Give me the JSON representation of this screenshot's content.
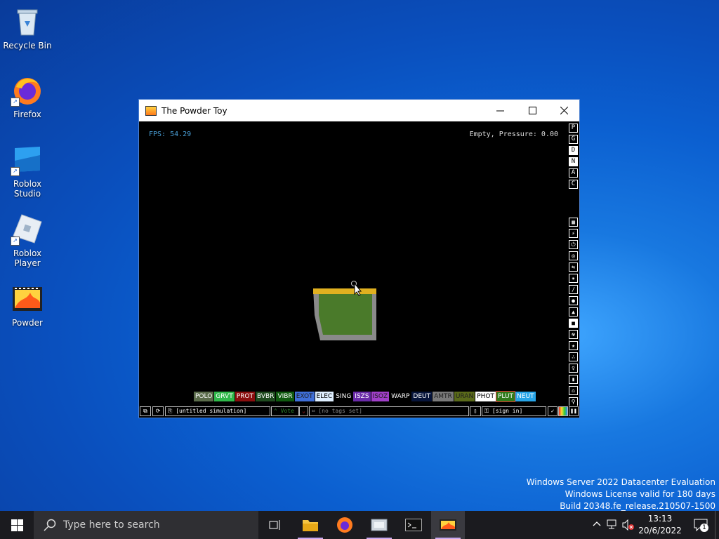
{
  "desktop": {
    "icons": [
      {
        "label": "Recycle Bin"
      },
      {
        "label": "Firefox"
      },
      {
        "label": "Roblox Studio"
      },
      {
        "label": "Roblox Player"
      },
      {
        "label": "Powder"
      }
    ]
  },
  "window": {
    "title": "The Powder Toy",
    "minimize": "—",
    "maximize": "☐",
    "close": "✕",
    "fps": "FPS: 54.29",
    "status": "Empty, Pressure: 0.00",
    "right_letters": [
      "P",
      "G",
      "D",
      "N",
      "A",
      "C"
    ],
    "elements": [
      {
        "label": "POLO",
        "bg": "#5a6b4a",
        "fg": "#ffffff"
      },
      {
        "label": "GRVT",
        "bg": "#2fb84a",
        "fg": "#ffffff"
      },
      {
        "label": "PROT",
        "bg": "#8a0e0e",
        "fg": "#ffffff"
      },
      {
        "label": "BVBR",
        "bg": "#1e4a1e",
        "fg": "#ffffff"
      },
      {
        "label": "VIBR",
        "bg": "#0f5a0f",
        "fg": "#ffffff"
      },
      {
        "label": "EXOT",
        "bg": "#3f6fd8",
        "fg": "#1e1e1e"
      },
      {
        "label": "ELEC",
        "bg": "#dfefff",
        "fg": "#000000"
      },
      {
        "label": "SING",
        "bg": "#000000",
        "fg": "#ffffff"
      },
      {
        "label": "ISZS",
        "bg": "#6a2aa8",
        "fg": "#ffffff"
      },
      {
        "label": "ISOZ",
        "bg": "#a03fc8",
        "fg": "#1e1e1e"
      },
      {
        "label": "WARP",
        "bg": "#000000",
        "fg": "#ffffff"
      },
      {
        "label": "DEUT",
        "bg": "#06143a",
        "fg": "#ffffff"
      },
      {
        "label": "AMTR",
        "bg": "#7a7a7a",
        "fg": "#1e1e1e"
      },
      {
        "label": "URAN",
        "bg": "#5a6a1a",
        "fg": "#1e1e1e"
      },
      {
        "label": "PHOT",
        "bg": "#ffffff",
        "fg": "#000000"
      },
      {
        "label": "PLUT",
        "bg": "#2f7a1a",
        "fg": "#ffffff",
        "selected": true
      },
      {
        "label": "NEUT",
        "bg": "#27a5e8",
        "fg": "#ffffff"
      }
    ],
    "bottom": {
      "sim_name": "[untitled simulation]",
      "vote": "Vote",
      "tags": "[no tags set]",
      "sign_in": "[sign in]"
    }
  },
  "watermark": {
    "line1": "Windows Server 2022 Datacenter Evaluation",
    "line2": "Windows License valid for 180 days",
    "line3": "Build 20348.fe_release.210507-1500"
  },
  "taskbar": {
    "search_placeholder": "Type here to search",
    "time": "13:13",
    "date": "20/6/2022",
    "notifications": "1"
  }
}
